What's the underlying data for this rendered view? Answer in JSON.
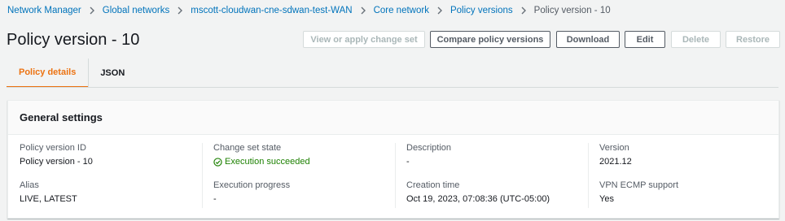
{
  "breadcrumb": {
    "items": [
      "Network Manager",
      "Global networks",
      "mscott-cloudwan-cne-sdwan-test-WAN",
      "Core network",
      "Policy versions"
    ],
    "current": "Policy version - 10"
  },
  "page_title": "Policy version - 10",
  "actions": {
    "view_apply": "View or apply change set",
    "compare": "Compare policy versions",
    "download": "Download",
    "edit": "Edit",
    "delete": "Delete",
    "restore": "Restore"
  },
  "tabs": [
    "Policy details",
    "JSON"
  ],
  "general_settings": {
    "title": "General settings",
    "policy_version_id": {
      "label": "Policy version ID",
      "value": "Policy version - 10"
    },
    "alias": {
      "label": "Alias",
      "value": "LIVE, LATEST"
    },
    "change_set_state": {
      "label": "Change set state",
      "value": "Execution succeeded"
    },
    "execution_progress": {
      "label": "Execution progress",
      "value": "-"
    },
    "description": {
      "label": "Description",
      "value": "-"
    },
    "creation_time": {
      "label": "Creation time",
      "value": "Oct 19, 2023, 07:08:36 (UTC-05:00)"
    },
    "version": {
      "label": "Version",
      "value": "2021.12"
    },
    "vpn_ecmp": {
      "label": "VPN ECMP support",
      "value": "Yes"
    }
  },
  "colors": {
    "link": "#0073bb",
    "accent": "#ec7211",
    "success": "#1d8102"
  },
  "icons": {
    "breadcrumb_separator": "chevron-right-icon",
    "status": "check-circle-icon"
  }
}
